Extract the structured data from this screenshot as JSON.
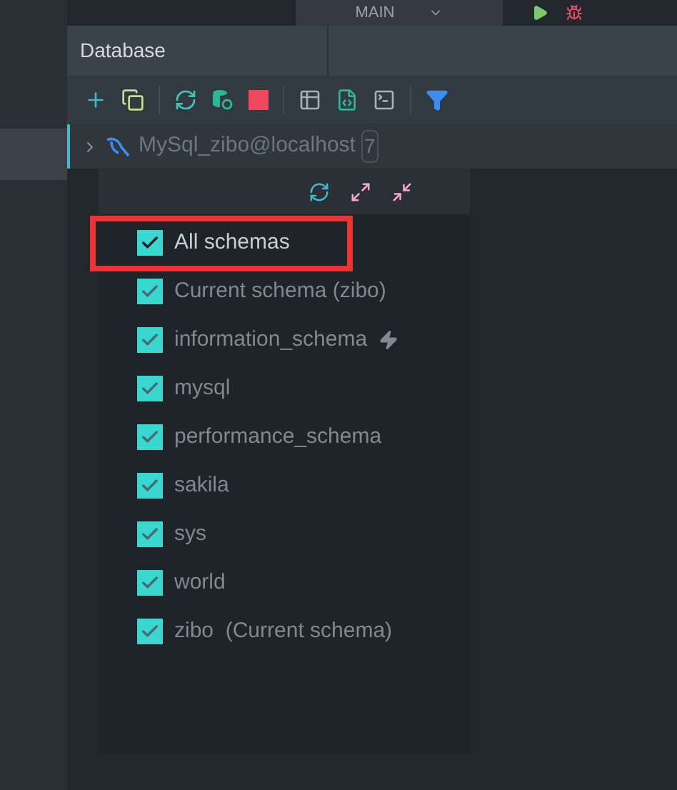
{
  "top_bar": {
    "configuration": "MAIN"
  },
  "panel": {
    "title": "Database"
  },
  "tree": {
    "connection": "MySql_zibo@localhost",
    "count": "7",
    "expanded": false
  },
  "schemas_popup": {
    "items": [
      {
        "label": "All schemas",
        "checked": true,
        "highlighted": true,
        "flag": false
      },
      {
        "label": "Current schema (zibo)",
        "checked": true,
        "highlighted": false,
        "flag": false
      },
      {
        "label": "information_schema",
        "checked": true,
        "highlighted": false,
        "flag": true
      },
      {
        "label": "mysql",
        "checked": true,
        "highlighted": false,
        "flag": false
      },
      {
        "label": "performance_schema",
        "checked": true,
        "highlighted": false,
        "flag": false
      },
      {
        "label": "sakila",
        "checked": true,
        "highlighted": false,
        "flag": false
      },
      {
        "label": "sys",
        "checked": true,
        "highlighted": false,
        "flag": false
      },
      {
        "label": "world",
        "checked": true,
        "highlighted": false,
        "flag": false
      },
      {
        "label": "zibo  (Current schema)",
        "checked": true,
        "highlighted": false,
        "flag": false
      }
    ]
  }
}
